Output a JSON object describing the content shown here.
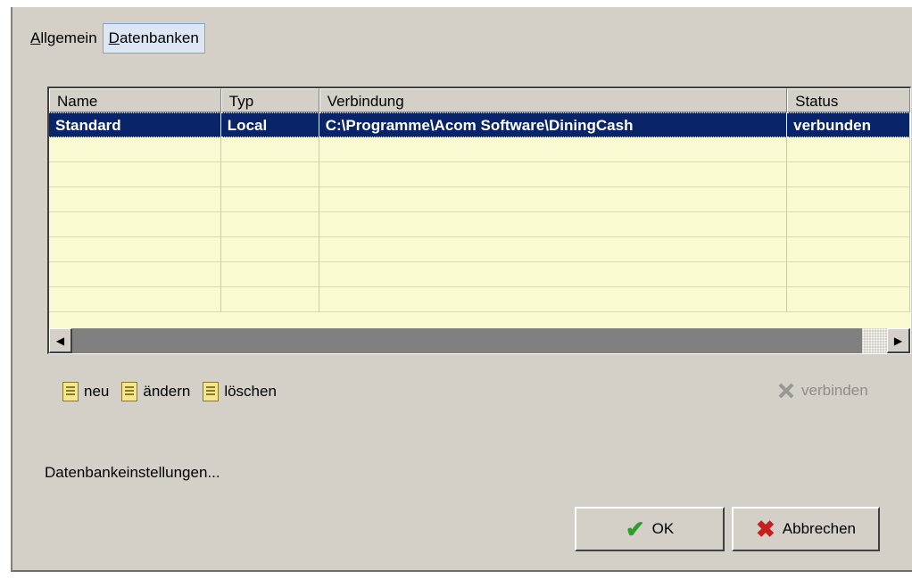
{
  "tabs": [
    {
      "label": "Allgemein",
      "active": false
    },
    {
      "label": "Datenbanken",
      "active": true
    }
  ],
  "table": {
    "columns": [
      "Name",
      "Typ",
      "Verbindung",
      "Status"
    ],
    "rows": [
      {
        "name": "Standard",
        "typ": "Local",
        "verbindung": "C:\\Programme\\Acom Software\\DiningCash",
        "status": "verbunden",
        "selected": true
      }
    ],
    "empty_rows": 7
  },
  "actions": {
    "new_label": "neu",
    "edit_label": "ändern",
    "delete_label": "löschen",
    "connect_label": "verbinden"
  },
  "settings_label": "Datenbankeinstellungen...",
  "buttons": {
    "ok_label": "OK",
    "cancel_label": "Abbrechen"
  },
  "icons": {
    "new": "new-doc-icon",
    "edit": "edit-doc-icon",
    "delete": "delete-doc-icon",
    "connect": "connect-icon",
    "ok": "check-icon",
    "cancel": "x-icon",
    "scroll_left": "arrow-left-icon",
    "scroll_right": "arrow-right-icon"
  },
  "colors": {
    "dialog_bg": "#d4d0c8",
    "grid_bg": "#fafad2",
    "selection": "#0a246a",
    "disabled_text": "#8f8c86",
    "check_green": "#2e9d2e",
    "cancel_red": "#c81e1e"
  }
}
